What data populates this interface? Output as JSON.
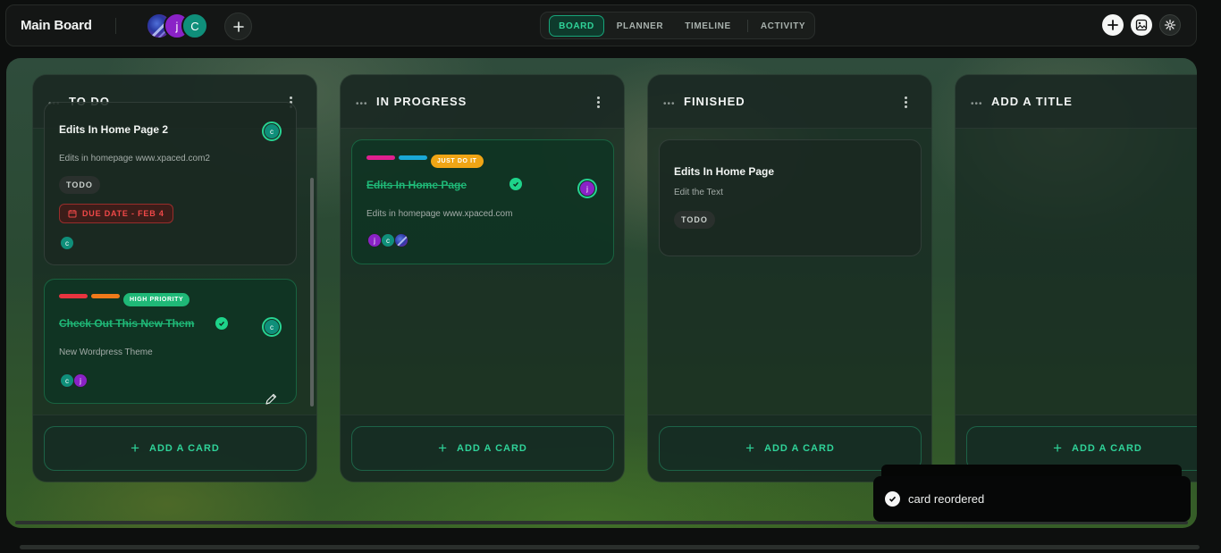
{
  "app": {
    "title": "Main Board"
  },
  "members": [
    {
      "kind": "image",
      "initial": ""
    },
    {
      "kind": "letter",
      "initial": "j",
      "color": "#8a22c7"
    },
    {
      "kind": "letter",
      "initial": "C",
      "color": "#0f8f7a"
    }
  ],
  "nav": {
    "tabs": [
      "BOARD",
      "PLANNER",
      "TIMELINE",
      "ACTIVITY"
    ],
    "active": "BOARD"
  },
  "toolbar": {
    "add_icon": "plus-icon",
    "background_icon": "image-icon",
    "settings_icon": "gear-icon"
  },
  "columns": [
    {
      "title": "TO DO",
      "add_label": "ADD A CARD",
      "cards": [
        {
          "title": "Edits In Home Page 2",
          "description": "Edits in homepage www.xpaced.com2",
          "status": "TODO",
          "due": "DUE DATE - FEB 4",
          "assignee": "c",
          "members": [
            "c"
          ]
        },
        {
          "labels": [
            "#e8343f",
            "#f07a1a"
          ],
          "badge": "HIGH PRIORITY",
          "badge_color": "#1fb877",
          "title": "Check Out This New Them",
          "completed": true,
          "description": "New Wordpress Theme",
          "assignee": "c",
          "members": [
            "c",
            "j"
          ]
        }
      ]
    },
    {
      "title": "IN PROGRESS",
      "add_label": "ADD A CARD",
      "cards": [
        {
          "labels": [
            "#e0208f",
            "#1aa8d6"
          ],
          "badge": "JUST DO IT",
          "badge_color": "#f0a515",
          "title": "Edits In Home Page",
          "completed": true,
          "description": "Edits in homepage www.xpaced.com",
          "assignee": "j",
          "members": [
            "j",
            "c",
            "img"
          ]
        }
      ]
    },
    {
      "title": "FINISHED",
      "add_label": "ADD A CARD",
      "cards": [
        {
          "title": "Edits In Home Page",
          "description": "Edit the Text",
          "status": "TODO"
        }
      ]
    },
    {
      "title": "ADD A TITLE",
      "add_label": "ADD A CARD",
      "cards": []
    }
  ],
  "toast": {
    "message": "card reordered"
  },
  "colors": {
    "accent": "#2fd399",
    "danger": "#f04848"
  }
}
